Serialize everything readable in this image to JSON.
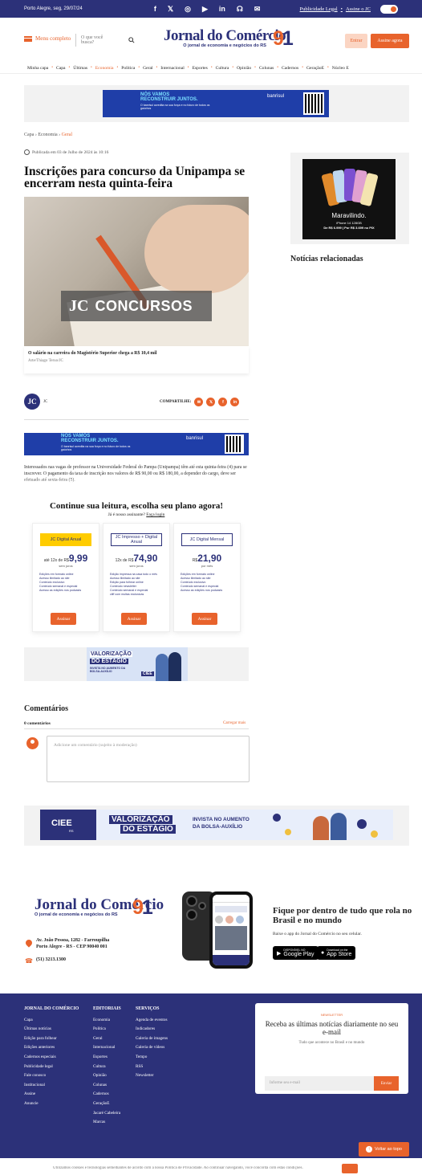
{
  "topbar": {
    "date": "Porto Alegre, seg, 29/07/24",
    "social": [
      "f",
      "𝕏",
      "◎",
      "▶",
      "in",
      "☊",
      "✉"
    ],
    "link1": "Publicidade Legal",
    "sep": "•",
    "link2": "Assine o JC"
  },
  "header": {
    "menu_label": "Menu completo",
    "search_placeholder": "O que você busca?",
    "logo_title": "Jornal do Comércio",
    "logo_sub": "O jornal de economia e negócios do RS",
    "logo_num": "9",
    "logo_num2": "1",
    "entrar": "Entrar",
    "assine": "Assine agora"
  },
  "nav": [
    "Minha capa",
    "Capa",
    "Últimas",
    "Economia",
    "Política",
    "Geral",
    "Internacional",
    "Esportes",
    "Cultura",
    "Opinião",
    "Colunas",
    "Cadernos",
    "GeraçãoE",
    "Núcleo E"
  ],
  "nav_active": "Economia",
  "ad_top": {
    "l1": "NÓS VAMOS",
    "l2": "RECONSTRUIR JUNTOS.",
    "l3": "O banrisul acredita na sua força e no futuro de todos os gaúchos",
    "brand": "banrisul"
  },
  "breadcrumb": {
    "c1": "Capa",
    "c2": "Economia",
    "c3": "Geral",
    "sep": "›"
  },
  "published": "Publicada em 03 de Julho de 2024 às 10:16",
  "title": "Inscrições para concurso da Unipampa se encerram nesta quinta-feira",
  "photo": {
    "tag_jc": "JC",
    "tag_text": "CONCURSOS"
  },
  "caption": {
    "text": "O salário na carreira do Magistério Superior chega a R$ 10,4 mil",
    "credit": "Arte/Thiago Teruo/JC"
  },
  "author": {
    "initials": "JC",
    "name": "JC"
  },
  "share_label": "COMPARTILHE:",
  "share_icons": [
    "✉",
    "𝕏",
    "f",
    "in"
  ],
  "intro": "Interessados nas vagas de professor na Universidade Federal do Pampa (Unipampa) têm até esta quinta-feira (4) para se inscrever. O pagamento da taxa de inscrição nos valores de R$ 90,00 ou R$ 180,00, a depender do cargo, deve ser efetuado até sexta-feira (5).",
  "plans_heading": "Continue sua leitura, escolha seu plano agora!",
  "plans_sub": "Já é nosso assinante?",
  "plans_login": "Faça login",
  "plans": [
    {
      "name": "JC Digital Anual",
      "prefix": "até 12x de R$",
      "price": "9,99",
      "per": "sem juros",
      "style": "yellow",
      "items": [
        "Edições em formato online",
        "Acesso ilimitado ao site",
        "Conteúdo exclusivo",
        "Conteúdo semanal e especial",
        "Acesso as edições nos podcasts"
      ]
    },
    {
      "name": "JC Impresso + Digital Anual",
      "prefix": "12x de R$",
      "price": "74,90",
      "per": "sem juros",
      "style": "outline",
      "items": [
        "Edição impressa na casa todo o mês",
        "Acesso ilimitado ao site",
        "Edição para folhear online",
        "Conteúdo newsletter",
        "Conteúdo semanal e especial",
        "cliff com multas exclusivas"
      ]
    },
    {
      "name": "JC Digital Mensal",
      "prefix": "R$",
      "price": "21,90",
      "per": "por mês",
      "style": "outline",
      "items": [
        "Edições em formato online",
        "Acesso ilimitado ao site",
        "Conteúdo exclusivo",
        "Conteúdo semanal e especial",
        "Acesso as edições nos podcasts"
      ]
    }
  ],
  "plan_btn": "Assinar",
  "ciee_small": {
    "l1": "VALORIZAÇÃO",
    "l2": "DO ESTÁGIO",
    "l3": "INVISTA NO AUMENTO DA BOLSA-AUXÍLIO",
    "brand": "CIEE"
  },
  "comments": {
    "heading": "Comentários",
    "count": "0 comentários",
    "link": "Carregar mais",
    "placeholder": "Adicione um comentário (sujeito à moderação)"
  },
  "ciee_wide": {
    "brand": "CIEE",
    "sub": "RS",
    "l1": "VALORIZAÇÃO",
    "l2": "DO ESTÁGIO",
    "l3": "INVISTA NO AUMENTO",
    "l4": "DA BOLSA-AUXÍLIO"
  },
  "side_ad": {
    "l1": "Maravilindo.",
    "l2": "iPhone 14 128GB",
    "l3": "De R$ 6.999 | Por R$ 3.699 no PIX"
  },
  "related_heading": "Notícias relacionadas",
  "app": {
    "address": "Av. João Pessoa, 1282 - Farroupilha\nPorto Alegre - RS - CEP 90040 001",
    "phone": "(51) 3213.1300",
    "heading": "Fique por dentro de tudo que rola no Brasil e no mundo",
    "sub": "Baixe o app do Jornal do Comércio no seu celular.",
    "gp_small": "DISPONÍVEL NO",
    "gp": "Google Play",
    "as_small": "Download on the",
    "as": "App Store"
  },
  "footer": {
    "col1": {
      "h": "JORNAL DO COMÉRCIO",
      "items": [
        "Capa",
        "Últimas notícias",
        "Edição para folhear",
        "Edições anteriores",
        "Cadernos especiais",
        "Publicidade legal",
        "Fale conosco",
        "Institucional",
        "Assine",
        "Anuncie"
      ]
    },
    "col2": {
      "h": "EDITORIAIS",
      "items": [
        "Economia",
        "Política",
        "Geral",
        "Internacional",
        "Esportes",
        "Cultura",
        "Opinião",
        "Colunas",
        "Cadernos",
        "GeraçãoE",
        "Jacaré Cabeleira",
        "Marcas"
      ]
    },
    "col3": {
      "h": "SERVIÇOS",
      "items": [
        "Agenda de eventos",
        "Indicadores",
        "Galeria de imagens",
        "Galeria de vídeos",
        "Tempo",
        "RSS",
        "Newsletter"
      ]
    }
  },
  "newsletter": {
    "label": "NEWSLETTER",
    "heading": "Receba as últimas notícias diariamente no seu e-mail",
    "sub": "Tudo que acontece no Brasil e no mundo",
    "placeholder": "Informe seu e-mail",
    "button": "Enviar"
  },
  "back_top": "Voltar ao topo",
  "cookie": "Utilizamos cookies e tecnologias semelhantes de acordo com a nossa Política de Privacidade. Ao continuar navegando, você concorda com estas condições."
}
